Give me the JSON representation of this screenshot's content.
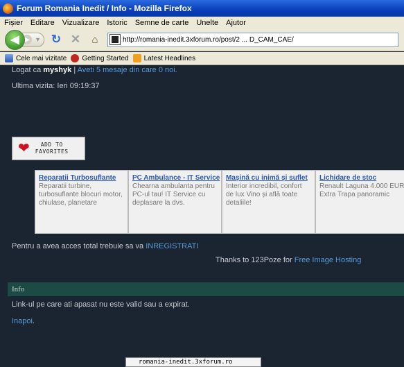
{
  "window": {
    "title": "Forum Romania Inedit / Info - Mozilla Firefox"
  },
  "menu": [
    "Fișier",
    "Editare",
    "Vizualizare",
    "Istoric",
    "Semne de carte",
    "Unelte",
    "Ajutor"
  ],
  "url": "http://romania-inedit.3xforum.ro/post/2 ... D_CAM_CAE/",
  "bookmarks": [
    "Cele mai vizitate",
    "Getting Started",
    "Latest Headlines"
  ],
  "page": {
    "logged_prefix": "Logat ca",
    "username": "myshyk",
    "separator": "|",
    "messages_text": "Aveti 5 mesaje din care 0 noi.",
    "last_visit": "Ultima vizita: Ieri 09:19:37",
    "fav_line1": "ADD TO",
    "fav_line2": "FAVORITES",
    "ads": [
      {
        "title": "Reparatii Turbosuflante",
        "text": "Reparatii turbine, turbosuflante blocuri motor, chiulase, planetare"
      },
      {
        "title": "PC Ambulance - IT Service",
        "text": "Chearna ambulanta pentru PC-ul tau! IT Service cu deplasare la dvs."
      },
      {
        "title": "Mașină cu inimă și suflet",
        "text": "Interior incredibil, confort de lux Vino și află toate detaliile!"
      },
      {
        "title": "Lichidare de stoc",
        "text": "Renault Laguna 4.000 EUR Extra Trapa panoramic"
      }
    ],
    "access_text": "Pentru a avea acces total trebuie sa va",
    "register_link": "INREGISTRATI",
    "thanks_text": "Thanks to 123Poze for",
    "hosting_link": "Free Image Hosting",
    "info_title": "Info",
    "invalid_text": "Link-ul pe care ati apasat nu este valid sau a expirat.",
    "back_link": "Inapoi",
    "back_suffix": "."
  },
  "status": {
    "text": "romania-inedit.3xforum.ro"
  }
}
